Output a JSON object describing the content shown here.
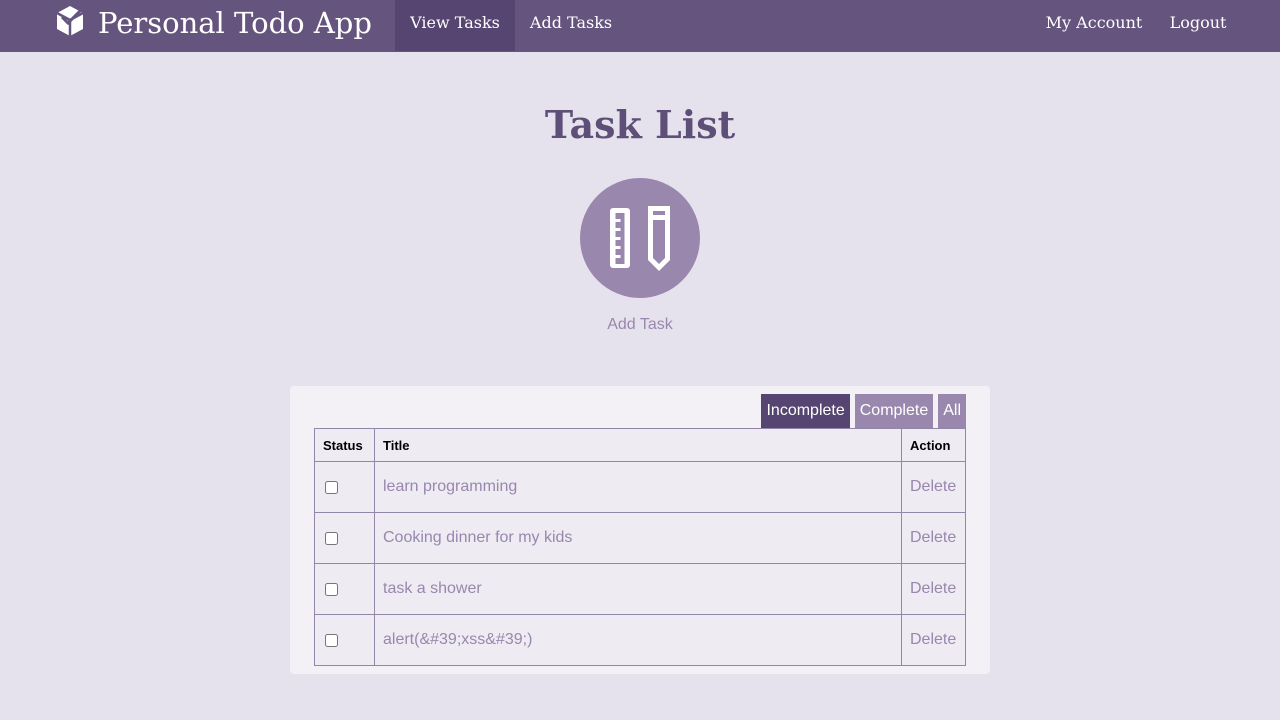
{
  "brand": {
    "title": "Personal Todo App",
    "icon": "cube-check-icon"
  },
  "nav": {
    "left": [
      {
        "label": "View Tasks",
        "active": true
      },
      {
        "label": "Add Tasks",
        "active": false
      }
    ],
    "right": [
      {
        "label": "My Account"
      },
      {
        "label": "Logout"
      }
    ]
  },
  "main": {
    "title": "Task List",
    "add_icon": "ruler-pencil-icon",
    "add_label": "Add Task"
  },
  "filters": [
    {
      "label": "Incomplete",
      "active": true
    },
    {
      "label": "Complete",
      "active": false
    },
    {
      "label": "All",
      "active": false
    }
  ],
  "table": {
    "headers": [
      "Status",
      "Title",
      "Action"
    ],
    "rows": [
      {
        "checked": false,
        "title": "learn programming",
        "action": "Delete"
      },
      {
        "checked": false,
        "title": "Cooking dinner for my kids",
        "action": "Delete"
      },
      {
        "checked": false,
        "title": "task a shower",
        "action": "Delete"
      },
      {
        "checked": false,
        "title": "alert(&#39;xss&#39;)",
        "action": "Delete"
      }
    ]
  },
  "colors": {
    "nav": "#64547e",
    "nav_active": "#564570",
    "accent": "#9987ae",
    "background": "#e6e2ed"
  }
}
